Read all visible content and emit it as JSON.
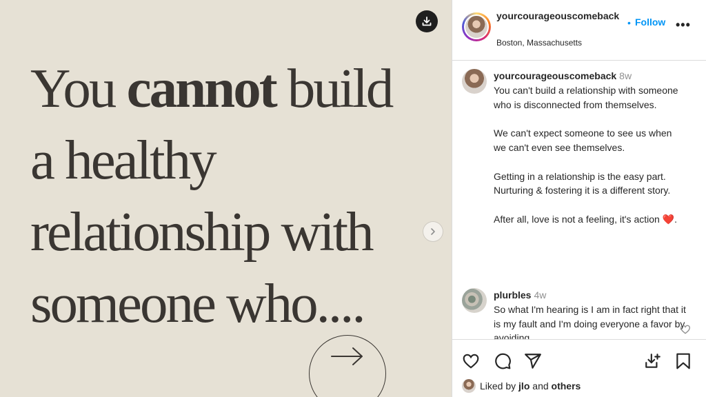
{
  "post": {
    "quote_line1_pre": "You ",
    "quote_line1_bold": "cannot",
    "quote_line1_post": " build",
    "quote_line2": "a healthy",
    "quote_line3": "relationship with",
    "quote_line4": "someone who...."
  },
  "header": {
    "username": "yourcourageouscomeback",
    "dot": "•",
    "follow_label": "Follow",
    "more": "•••",
    "location": "Boston, Massachusetts"
  },
  "caption": {
    "username": "yourcourageouscomeback",
    "time": "8w",
    "para1": "You can't build a relationship with someone who is disconnected from themselves.",
    "para2": "We can't expect someone to see us when we can't even see themselves.",
    "para3": "Getting in a relationship is the easy part. Nurturing & fostering it is a different story.",
    "para4": "After all, love is not a feeling, it's action",
    "para4_emoji": "❤️",
    "para4_end": "."
  },
  "comment1": {
    "username": "plurbles",
    "time": "4w",
    "text": "So what I'm hearing is I am in fact right that it is my fault and I'm doing everyone a favor by avoiding"
  },
  "liked": {
    "prefix": "Liked by ",
    "user": "jlo",
    "middle": " and ",
    "others": "others"
  },
  "icons": [
    "download-icon",
    "chevron-right-icon",
    "arrow-right-icon",
    "heart-icon",
    "comment-icon",
    "share-icon",
    "save-to-collection-icon",
    "bookmark-icon"
  ]
}
